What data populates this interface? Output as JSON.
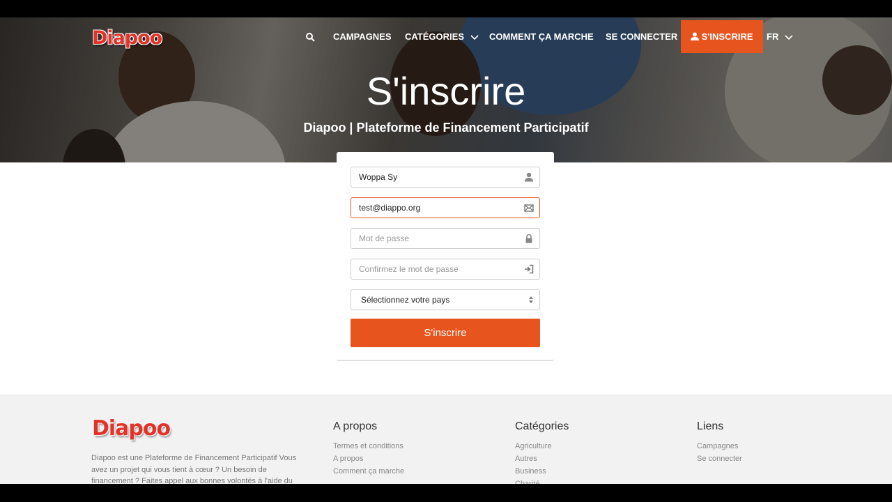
{
  "nav": {
    "logo": "Diapoo",
    "items": [
      "CAMPAGNES",
      "CATÉGORIES",
      "COMMENT ÇA MARCHE",
      "SE CONNECTER"
    ],
    "signup": "S'INSCRIRE",
    "lang": "FR"
  },
  "hero": {
    "title": "S'inscrire",
    "subtitle": "Diapoo | Plateforme de Financement Participatif"
  },
  "form": {
    "name_value": "Woppa Sy",
    "email_value": "test@diappo.org",
    "password_placeholder": "Mot de passe",
    "confirm_placeholder": "Confirmez le mot de passe",
    "country_selected": "Sélectionnez votre pays",
    "submit_label": "S'inscrire"
  },
  "footer": {
    "logo": "Diapoo",
    "description": "Diapoo est une Plateforme de Financement Participatif Vous avez un projet qui vous tient à cœur ? Un besoin de financement ? Faites appel aux bonnes volontés à l'aide du",
    "about": {
      "title": "A propos",
      "links": [
        "Termes et conditions",
        "A propos",
        "Comment ça marche"
      ]
    },
    "categories": {
      "title": "Catégories",
      "links": [
        "Agriculture",
        "Autres",
        "Business",
        "Charité"
      ]
    },
    "links": {
      "title": "Liens",
      "links": [
        "Campagnes",
        "Se connecter"
      ]
    }
  },
  "colors": {
    "accent": "#e8541e",
    "logo_red": "#e2332a"
  },
  "icons": [
    "search-icon",
    "chevron-down-icon",
    "user-icon",
    "envelope-icon",
    "lock-icon",
    "sign-in-icon",
    "select-caret-icon"
  ]
}
